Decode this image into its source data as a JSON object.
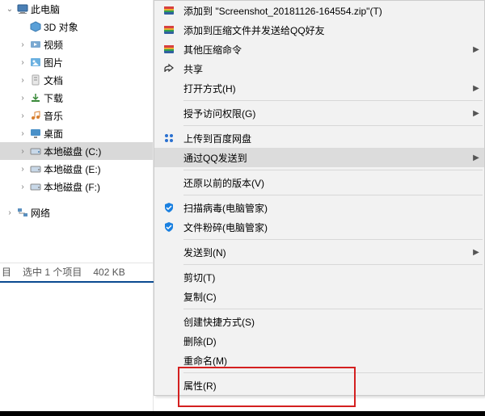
{
  "tree": {
    "root": "此电脑",
    "items": [
      "3D 对象",
      "视频",
      "图片",
      "文档",
      "下载",
      "音乐",
      "桌面",
      "本地磁盘 (C:)",
      "本地磁盘 (E:)",
      "本地磁盘 (F:)"
    ],
    "network": "网络"
  },
  "status": {
    "items": "目",
    "selection": "选中 1 个项目",
    "size": "402 KB"
  },
  "menu": {
    "addToZip": "添加到 \"Screenshot_20181126-164554.zip\"(T)",
    "addSendQQ": "添加到压缩文件并发送给QQ好友",
    "otherCompress": "其他压缩命令",
    "share": "共享",
    "openWith": "打开方式(H)",
    "grantAccess": "授予访问权限(G)",
    "uploadBaidu": "上传到百度网盘",
    "sendQQ": "通过QQ发送到",
    "restoreVersions": "还原以前的版本(V)",
    "scanVirus": "扫描病毒(电脑管家)",
    "fileShred": "文件粉碎(电脑管家)",
    "sendTo": "发送到(N)",
    "cut": "剪切(T)",
    "copy": "复制(C)",
    "createShortcut": "创建快捷方式(S)",
    "delete": "删除(D)",
    "rename": "重命名(M)",
    "properties": "属性(R)"
  }
}
